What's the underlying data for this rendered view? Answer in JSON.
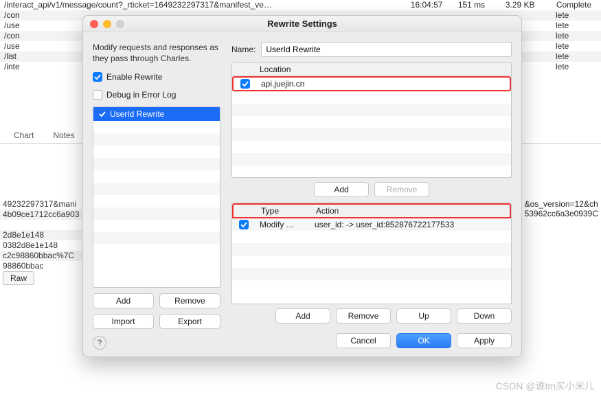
{
  "bg": {
    "rows": [
      {
        "a": "/interact_api/v1/message/count?_rticket=1649232297317&manifest_ve…",
        "b": "16:04:57",
        "c": "151 ms",
        "d": "3.29 KB",
        "e": "Complete"
      },
      {
        "a": "/con",
        "b": "",
        "c": "",
        "d": "",
        "e": "lete"
      },
      {
        "a": "/use",
        "b": "",
        "c": "",
        "d": "",
        "e": "lete"
      },
      {
        "a": "/con",
        "b": "",
        "c": "",
        "d": "",
        "e": "lete"
      },
      {
        "a": "/use",
        "b": "",
        "c": "",
        "d": "",
        "e": "lete"
      },
      {
        "a": "/list",
        "b": "",
        "c": "",
        "d": "",
        "e": "lete"
      },
      {
        "a": "/inte",
        "b": "",
        "c": "",
        "d": "",
        "e": "lete"
      }
    ],
    "snippet": {
      "lines": [
        "49232297317&mani",
        "4b09ce1712cc6a903",
        "",
        "2d8e1e148",
        "0382d8e1e148",
        "c2c98860bbac%7C",
        "98860bbac"
      ],
      "right1": "&os_version=12&ch",
      "right2": "53962cc6a3e0939C"
    },
    "rawLabel": "Raw"
  },
  "tabs": {
    "chart": "Chart",
    "notes": "Notes"
  },
  "dialog": {
    "title": "Rewrite Settings",
    "desc": "Modify requests and responses as they pass through Charles.",
    "enableLabel": "Enable Rewrite",
    "debugLabel": "Debug in Error Log",
    "sets": [
      {
        "enabled": true,
        "name": "UserId Rewrite"
      }
    ],
    "setButtons": {
      "add": "Add",
      "remove": "Remove",
      "import": "Import",
      "export": "Export"
    },
    "nameLabel": "Name:",
    "nameValue": "UserId Rewrite",
    "locations": {
      "header": "Location",
      "rows": [
        {
          "enabled": true,
          "value": "api.juejin.cn"
        }
      ],
      "add": "Add",
      "remove": "Remove"
    },
    "rules": {
      "typeHeader": "Type",
      "actionHeader": "Action",
      "rows": [
        {
          "enabled": true,
          "type": "Modify …",
          "action": "user_id: -> user_id:852876722177533"
        }
      ],
      "add": "Add",
      "remove": "Remove",
      "up": "Up",
      "down": "Down"
    },
    "footer": {
      "cancel": "Cancel",
      "ok": "OK",
      "apply": "Apply"
    },
    "helpGlyph": "?"
  },
  "watermark": "CSDN @谁tm买小米儿"
}
